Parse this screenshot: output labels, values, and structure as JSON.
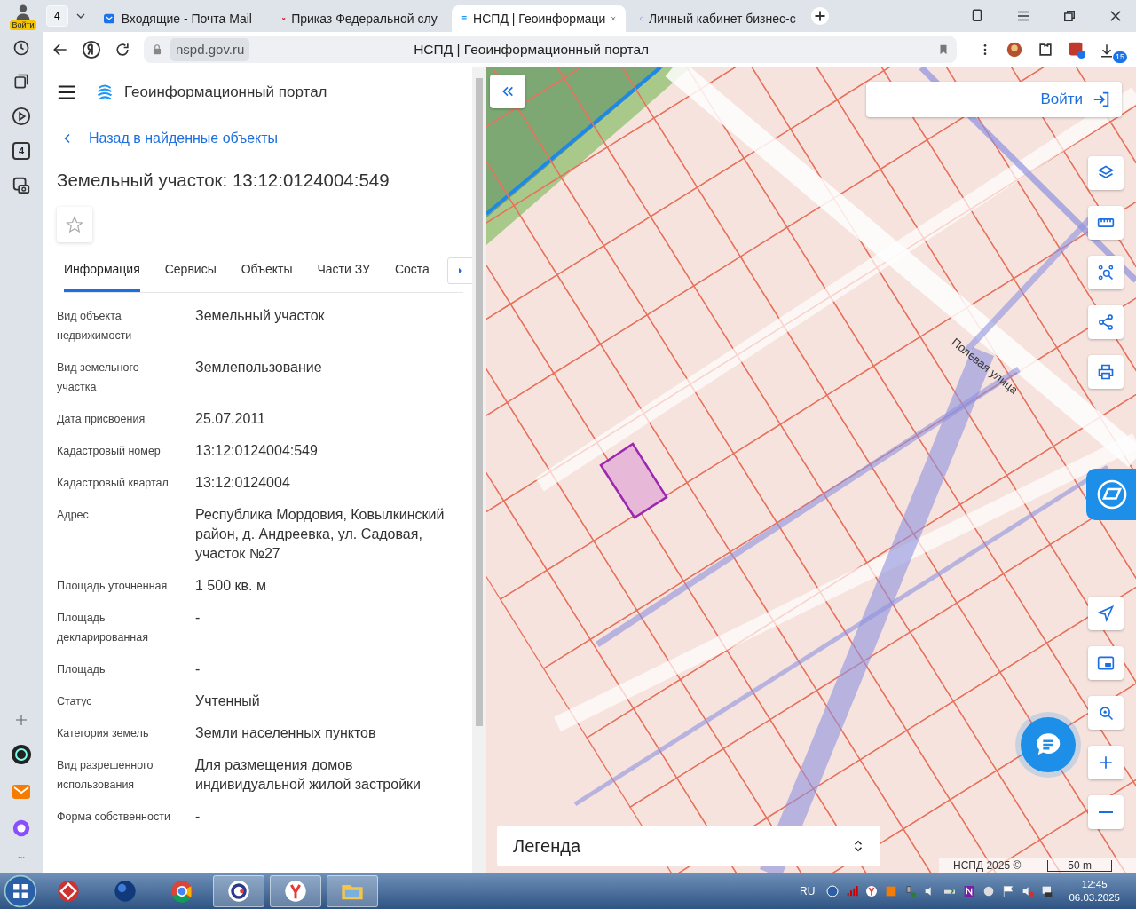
{
  "browser": {
    "profile_label": "Войти",
    "tab_count": "4",
    "tabs": [
      {
        "title": "Входящие - Почта Mail",
        "selected": false
      },
      {
        "title": "Приказ Федеральной слу",
        "selected": false
      },
      {
        "title": "НСПД | Геоинформаци",
        "selected": true
      },
      {
        "title": "Личный кабинет бизнес-с",
        "selected": false
      }
    ],
    "url": "nspd.gov.ru",
    "page_title": "НСПД | Геоинформационный портал",
    "download_count": "15",
    "sidebar_badge": "4"
  },
  "portal": {
    "title": "Геоинформационный портал",
    "back_link": "Назад в найденные объекты",
    "heading": "Земельный участок: 13:12:0124004:549",
    "tabs": [
      {
        "label": "Информация",
        "selected": true
      },
      {
        "label": "Сервисы",
        "selected": false
      },
      {
        "label": "Объекты",
        "selected": false
      },
      {
        "label": "Части ЗУ",
        "selected": false
      },
      {
        "label": "Соста",
        "selected": false
      }
    ],
    "fields": [
      {
        "label": "Вид объекта недвижимости",
        "value": "Земельный участок"
      },
      {
        "label": "Вид земельного участка",
        "value": "Землепользование"
      },
      {
        "label": "Дата присвоения",
        "value": "25.07.2011"
      },
      {
        "label": "Кадастровый номер",
        "value": "13:12:0124004:549"
      },
      {
        "label": "Кадастровый квартал",
        "value": "13:12:0124004"
      },
      {
        "label": "Адрес",
        "value": "Республика Мордовия, Ковылкинский район, д. Андреевка, ул. Садовая, участок №27"
      },
      {
        "label": "Площадь уточненная",
        "value": "1 500 кв. м"
      },
      {
        "label": "Площадь декларированная",
        "value": "-"
      },
      {
        "label": "Площадь",
        "value": "-"
      },
      {
        "label": "Статус",
        "value": "Учтенный"
      },
      {
        "label": "Категория земель",
        "value": "Земли населенных пунктов"
      },
      {
        "label": "Вид разрешенного использования",
        "value": "Для размещения домов индивидуальной жилой застройки"
      },
      {
        "label": "Форма собственности",
        "value": "-"
      }
    ]
  },
  "map": {
    "login": "Войти",
    "street_label": "Полевая улица",
    "legend": "Легенда",
    "attribution": "НСПД 2025 ©",
    "scale": "50 m"
  },
  "taskbar": {
    "language": "RU",
    "time": "12:45",
    "date": "06.03.2025"
  }
}
